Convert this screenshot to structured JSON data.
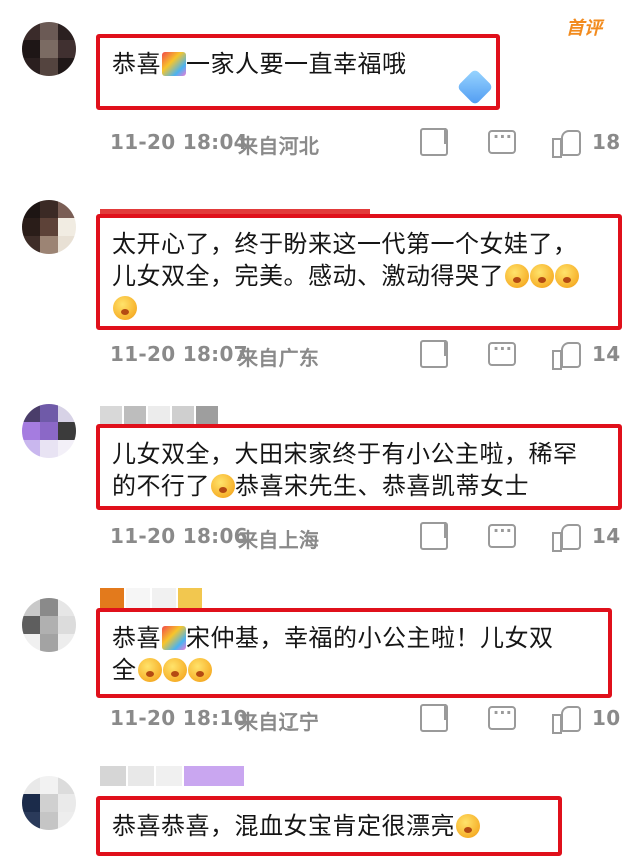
{
  "header": {
    "tag": "首评"
  },
  "comments": [
    {
      "text": "恭喜",
      "text2": "一家人要一直幸福哦",
      "time": "11-20 18:04",
      "location": "来自河北",
      "likes": "18"
    },
    {
      "text": "太开心了，终于盼来这一代第一个女娃了，\n儿女双全，完美。感动、激动得哭了",
      "time": "11-20 18:07",
      "location": "来自广东",
      "likes": "14"
    },
    {
      "text": "儿女双全，大田宋家终于有小公主啦，稀罕\n的不行了",
      "text2": "恭喜宋先生、恭喜凯蒂女士",
      "time": "11-20 18:06",
      "location": "来自上海",
      "likes": "14"
    },
    {
      "text": "恭喜",
      "text2": "宋仲基，幸福的小公主啦！儿女双\n全",
      "time": "11-20 18:10",
      "location": "来自辽宁",
      "likes": "10"
    },
    {
      "text": "恭喜恭喜，混血女宝肯定很漂亮"
    }
  ],
  "colors": {
    "highlight_border": "#e0101b",
    "meta_text": "#8a8a8a",
    "accent": "#f28b1e"
  },
  "icons": [
    "share-icon",
    "reply-icon",
    "like-icon",
    "emoji-icon"
  ]
}
